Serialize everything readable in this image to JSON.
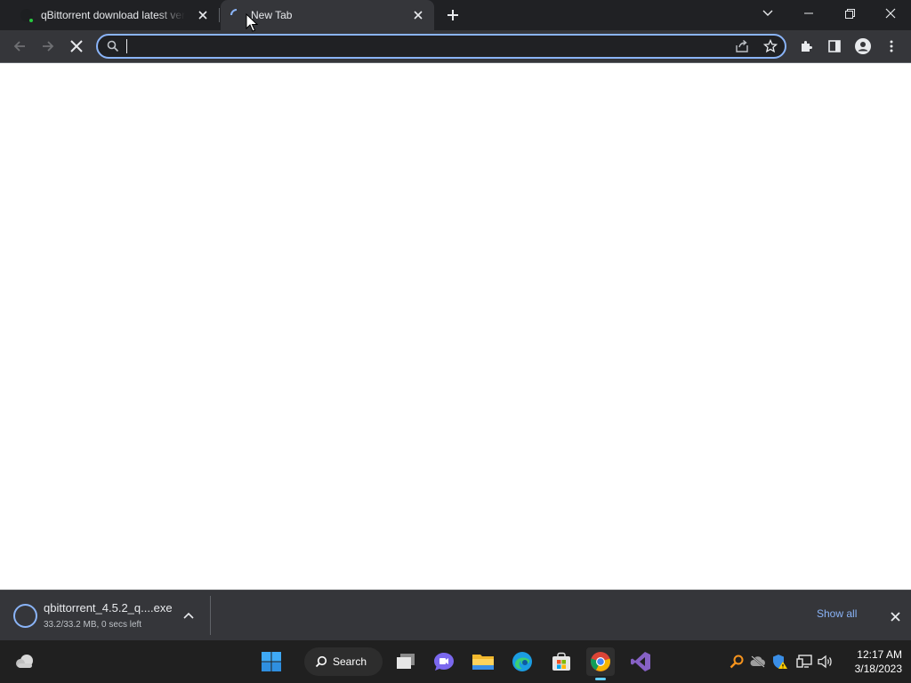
{
  "browser": {
    "tabs": [
      {
        "title": "qBittorrent download latest versi",
        "favicon": "qbittorrent-favicon-icon",
        "active": false
      },
      {
        "title": "New Tab",
        "favicon": "loading-spinner-icon",
        "active": true
      }
    ],
    "omnibox": {
      "value": "",
      "placeholder": ""
    },
    "colors": {
      "frame": "#202124",
      "toolbar": "#35363a",
      "accent": "#8ab4f8"
    }
  },
  "download_shelf": {
    "item": {
      "filename": "qbittorrent_4.5.2_q....exe",
      "status": "33.2/33.2 MB, 0 secs left"
    },
    "show_all_label": "Show all"
  },
  "taskbar": {
    "search_label": "Search",
    "pinned": [
      "start-icon",
      "search-icon",
      "task-view-icon",
      "chat-icon",
      "file-explorer-icon",
      "edge-icon",
      "store-icon",
      "chrome-icon",
      "visual-studio-icon"
    ],
    "clock": {
      "time": "12:17 AM",
      "date": "3/18/2023"
    }
  }
}
